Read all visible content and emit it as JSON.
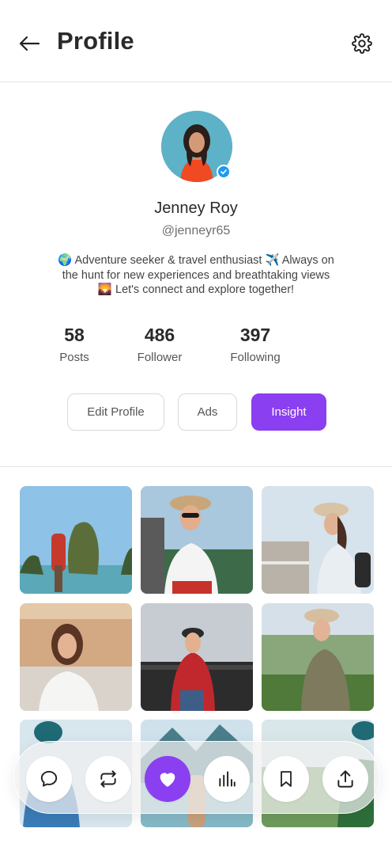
{
  "header": {
    "title": "Profile",
    "back_icon": "arrow-left-icon",
    "settings_icon": "gear-icon"
  },
  "profile": {
    "name": "Jenney Roy",
    "handle": "@jenneyr65",
    "bio": "🌍 Adventure seeker & travel enthusiast ✈️ Always on the hunt for new experiences and breathtaking views 🌄 Let's connect and explore together!",
    "verified": true
  },
  "stats": {
    "posts": {
      "value": "58",
      "label": "Posts"
    },
    "followers": {
      "value": "486",
      "label": "Follower"
    },
    "following": {
      "value": "397",
      "label": "Following"
    }
  },
  "actions": {
    "edit_profile": "Edit Profile",
    "ads": "Ads",
    "insight": "Insight"
  },
  "photos": [
    "photo-rock-island-backpacker",
    "photo-woman-sunglasses-hat",
    "photo-woman-hat-terrace",
    "photo-woman-smiling-street",
    "photo-woman-red-jacket-bridge",
    "photo-woman-hat-hills",
    "photo-backpacker-beanie",
    "photo-mountain-lake",
    "photo-backpacker-green"
  ],
  "bottom_nav": [
    {
      "icon": "comment-icon",
      "active": false
    },
    {
      "icon": "repost-icon",
      "active": false
    },
    {
      "icon": "heart-icon",
      "active": true
    },
    {
      "icon": "bar-chart-icon",
      "active": false
    },
    {
      "icon": "bookmark-icon",
      "active": false
    },
    {
      "icon": "share-upload-icon",
      "active": false
    }
  ],
  "colors": {
    "accent": "#8a3ff0",
    "verified": "#1d9bf0",
    "divider": "#e4e4e4"
  }
}
